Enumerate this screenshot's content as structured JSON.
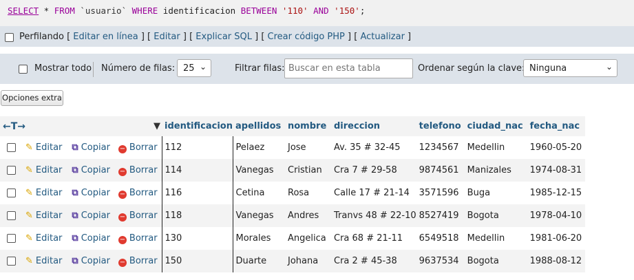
{
  "sql": {
    "select": "SELECT",
    "star_from": " * ",
    "from": "FROM",
    "table": " `usuario` ",
    "where": "WHERE",
    "col": " identificacion ",
    "between": "BETWEEN",
    "v1": " '110' ",
    "and": "AND",
    "v2": " '150'",
    "semi": ";"
  },
  "profiling": {
    "label": "Perfilando",
    "links": [
      "Editar en línea",
      "Editar",
      "Explicar SQL",
      "Crear código PHP",
      "Actualizar"
    ]
  },
  "nav": {
    "show_all": "Mostrar todo",
    "rows_label": "Número de filas:",
    "rows_value": "25",
    "filter_label": "Filtrar filas:",
    "search_placeholder": "Buscar en esta tabla",
    "sort_label": "Ordenar según la clave:",
    "sort_value": "Ninguna"
  },
  "extra_options": "Opciones extra",
  "table": {
    "arrows": "←T→",
    "columns": [
      "identificacion",
      "apellidos",
      "nombre",
      "direccion",
      "telefono",
      "ciudad_nac",
      "fecha_nac"
    ],
    "actions": {
      "edit": "Editar",
      "copy": "Copiar",
      "delete": "Borrar"
    },
    "rows": [
      [
        "112",
        "Pelaez",
        "Jose",
        "Av. 35 # 32-45",
        "1234567",
        "Medellin",
        "1960-05-20"
      ],
      [
        "114",
        "Vanegas",
        "Cristian",
        "Cra 7 # 29-58",
        "9874561",
        "Manizales",
        "1974-08-31"
      ],
      [
        "116",
        "Cetina",
        "Rosa",
        "Calle 17 # 21-14",
        "3571596",
        "Buga",
        "1985-12-15"
      ],
      [
        "118",
        "Vanegas",
        "Andres",
        "Tranvs 48 # 22-10",
        "8527419",
        "Bogota",
        "1978-04-10"
      ],
      [
        "130",
        "Morales",
        "Angelica",
        "Cra 68 # 21-11",
        "6549518",
        "Medellin",
        "1981-06-20"
      ],
      [
        "150",
        "Duarte",
        "Johana",
        "Cra 2 # 45-38",
        "9637534",
        "Bogota",
        "1988-08-12"
      ]
    ]
  },
  "colors": {
    "link": "#235a81",
    "keyword": "#990099",
    "string": "#aa1111",
    "toolbar_bg": "#dde3ea"
  }
}
